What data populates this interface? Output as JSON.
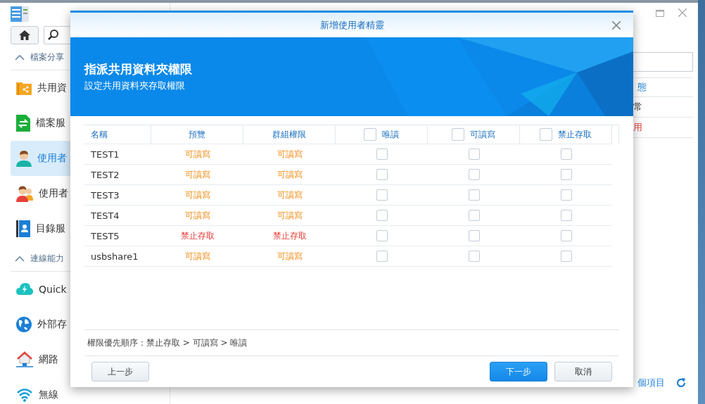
{
  "sidebar": {
    "sections": [
      {
        "title": "檔案分享",
        "expanded": true,
        "items": [
          {
            "label": "共用資",
            "selected": false
          },
          {
            "label": "檔案服",
            "selected": false
          },
          {
            "label": "使用者",
            "selected": true
          },
          {
            "label": "使用者",
            "selected": false
          },
          {
            "label": "目錄服",
            "selected": false
          }
        ]
      },
      {
        "title": "連線能力",
        "expanded": true,
        "items": [
          {
            "label": "Quick",
            "selected": false
          },
          {
            "label": "外部存",
            "selected": false
          },
          {
            "label": "網路",
            "selected": false
          },
          {
            "label": "無線",
            "selected": false
          }
        ]
      }
    ]
  },
  "background_table": {
    "column": "態",
    "cells": [
      {
        "text": "常",
        "kind": "normal"
      },
      {
        "text": "用",
        "kind": "disabled"
      }
    ],
    "footer": "個項目"
  },
  "dialog": {
    "title": "新增使用者精靈",
    "heading": "指派共用資料夾權限",
    "subheading": "設定共用資料夾存取權限",
    "columns": [
      {
        "label": "名稱",
        "kind": "text"
      },
      {
        "label": "預覽",
        "kind": "text"
      },
      {
        "label": "群組權限",
        "kind": "text"
      },
      {
        "label": "唯讀",
        "kind": "check",
        "checked": false
      },
      {
        "label": "可讀寫",
        "kind": "check",
        "checked": false
      },
      {
        "label": "禁止存取",
        "kind": "check",
        "checked": false
      }
    ],
    "rows": [
      {
        "name": "TEST1",
        "preview": {
          "text": "可讀寫",
          "kind": "rw"
        },
        "group": {
          "text": "可讀寫",
          "kind": "rw"
        },
        "read_only": false,
        "read_write": false,
        "no_access": false
      },
      {
        "name": "TEST2",
        "preview": {
          "text": "可讀寫",
          "kind": "rw"
        },
        "group": {
          "text": "可讀寫",
          "kind": "rw"
        },
        "read_only": false,
        "read_write": false,
        "no_access": false
      },
      {
        "name": "TEST3",
        "preview": {
          "text": "可讀寫",
          "kind": "rw"
        },
        "group": {
          "text": "可讀寫",
          "kind": "rw"
        },
        "read_only": false,
        "read_write": false,
        "no_access": false
      },
      {
        "name": "TEST4",
        "preview": {
          "text": "可讀寫",
          "kind": "rw"
        },
        "group": {
          "text": "可讀寫",
          "kind": "rw"
        },
        "read_only": false,
        "read_write": false,
        "no_access": false
      },
      {
        "name": "TEST5",
        "preview": {
          "text": "禁止存取",
          "kind": "deny"
        },
        "group": {
          "text": "禁止存取",
          "kind": "deny"
        },
        "read_only": false,
        "read_write": false,
        "no_access": false
      },
      {
        "name": "usbshare1",
        "preview": {
          "text": "可讀寫",
          "kind": "rw"
        },
        "group": {
          "text": "可讀寫",
          "kind": "rw"
        },
        "read_only": false,
        "read_write": false,
        "no_access": false
      }
    ],
    "note": "權限優先順序：禁止存取 > 可讀寫 > 唯讀",
    "buttons": [
      {
        "label": "上一步",
        "kind": "secondary"
      },
      {
        "label": "下一步",
        "kind": "primary"
      },
      {
        "label": "取消",
        "kind": "secondary"
      }
    ]
  }
}
